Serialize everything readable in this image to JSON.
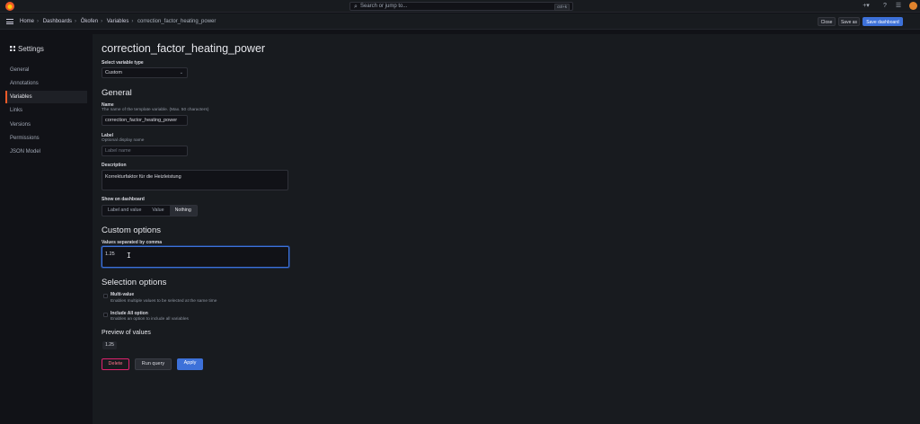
{
  "topbar": {
    "search_placeholder": "Search or jump to...",
    "search_shortcut": "ctrl+k",
    "plus_icon": "plus-icon",
    "help_icon": "help-icon",
    "news_icon": "rss-icon"
  },
  "breadcrumb": [
    "Home",
    "Dashboards",
    "Ökofen",
    "Variables",
    "correction_factor_heating_power"
  ],
  "actions": {
    "close": "Close",
    "save_as": "Save as",
    "save_dashboard": "Save dashboard"
  },
  "sidebar": {
    "title": "Settings",
    "items": [
      "General",
      "Annotations",
      "Variables",
      "Links",
      "Versions",
      "Permissions",
      "JSON Model"
    ],
    "active": "Variables"
  },
  "main": {
    "title": "correction_factor_heating_power",
    "variable_type": {
      "label": "Select variable type",
      "value": "Custom"
    },
    "general": {
      "heading": "General",
      "name_label": "Name",
      "name_desc": "The name of the template variable. (Max. 50 characters)",
      "name_value": "correction_factor_heating_power",
      "label_label": "Label",
      "label_desc": "Optional display name",
      "label_placeholder": "Label name",
      "description_label": "Description",
      "description_value": "Korrekturfaktor für die Heizleistung",
      "show_label": "Show on dashboard",
      "show_options": [
        "Label and value",
        "Value",
        "Nothing"
      ],
      "show_selected": "Nothing"
    },
    "custom": {
      "heading": "Custom options",
      "values_label": "Values separated by comma",
      "values_value": "1.25"
    },
    "selection": {
      "heading": "Selection options",
      "multi_label": "Multi-value",
      "multi_desc": "Enables multiple values to be selected at the same time",
      "all_label": "Include All option",
      "all_desc": "Enables an option to include all variables"
    },
    "preview": {
      "heading": "Preview of values",
      "values": [
        "1.25"
      ]
    },
    "buttons": {
      "delete": "Delete",
      "run_query": "Run query",
      "apply": "Apply"
    }
  },
  "colors": {
    "accent": "#3d71d9",
    "active_indicator": "#f05a28",
    "danger": "#e0226e"
  }
}
